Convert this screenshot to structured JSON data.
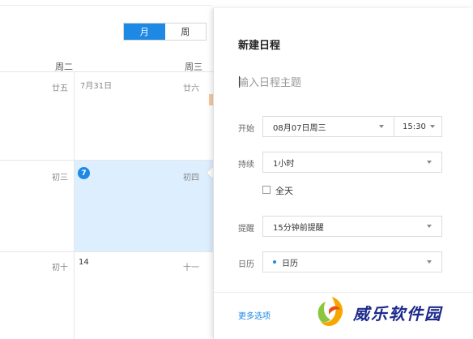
{
  "view_toggle": {
    "month": "月",
    "week": "周"
  },
  "weekdays": {
    "tue": "周二",
    "wed": "周三"
  },
  "calendar": {
    "row1": {
      "left": "廿五",
      "mid": "7月31日",
      "right": "廿六"
    },
    "row2": {
      "left": "初三",
      "today": "7",
      "right": "初四"
    },
    "row3": {
      "left": "初十",
      "mid": "14",
      "right": "十一"
    }
  },
  "panel": {
    "title": "新建日程",
    "subject_placeholder": "输入日程主题",
    "start": {
      "label": "开始",
      "date": "08月07日周三",
      "time": "15:30"
    },
    "duration": {
      "label": "持续",
      "value": "1小时"
    },
    "all_day": {
      "label": "全天",
      "checked": false
    },
    "reminder": {
      "label": "提醒",
      "value": "15分钟前提醒"
    },
    "calendar": {
      "label": "日历",
      "value": "日历"
    },
    "more_options": "更多选项"
  },
  "watermark": {
    "text": "威乐软件园"
  },
  "colors": {
    "accent": "#1e88e5",
    "selected_cell": "#ddeefe"
  }
}
